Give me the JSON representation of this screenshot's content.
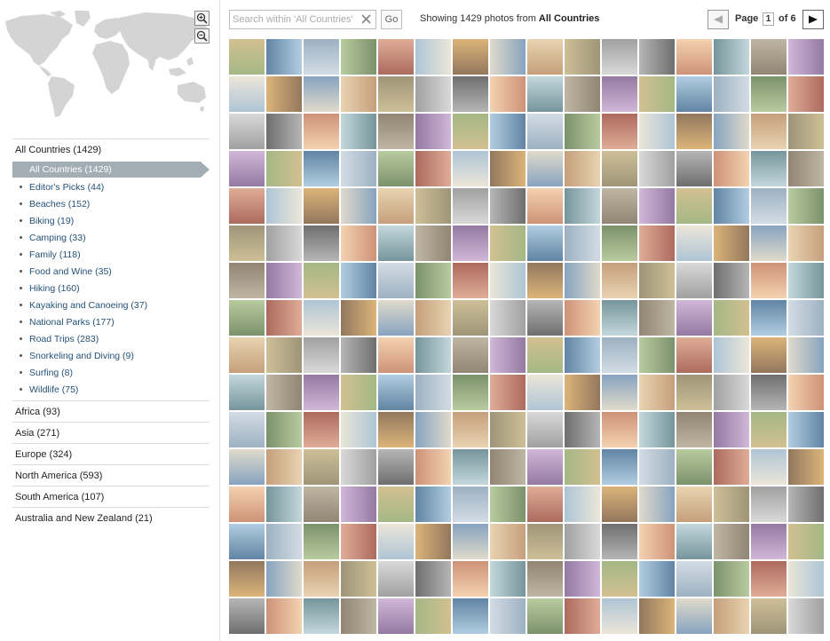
{
  "search": {
    "placeholder": "Search within 'All Countries'",
    "go_label": "Go"
  },
  "summary": {
    "prefix": "Showing 1429 photos from ",
    "location": "All Countries"
  },
  "pager": {
    "page_label": "Page",
    "current_page": "1",
    "of_label": "of 6"
  },
  "filter": {
    "all_countries_header": "All Countries (1429)",
    "selected_label": "All Countries (1429)",
    "categories": [
      "Editor's Picks (44)",
      "Beaches (152)",
      "Biking (19)",
      "Camping (33)",
      "Family (118)",
      "Food and Wine (35)",
      "Hiking (160)",
      "Kayaking and Canoeing (37)",
      "National Parks (177)",
      "Road Trips (283)",
      "Snorkeling and Diving (9)",
      "Surfing (8)",
      "Wildlife (75)"
    ],
    "regions": [
      "Africa (93)",
      "Asia (271)",
      "Europe (324)",
      "North America (593)",
      "South America (107)",
      "Australia and New Zealand (21)"
    ]
  },
  "icons": {
    "zoom_in": "zoom-in-magnifier-icon",
    "zoom_out": "zoom-out-magnifier-icon",
    "clear": "clear-x-icon",
    "prev": "left-arrow-icon",
    "next": "right-arrow-icon",
    "map": "world-map-icon"
  },
  "colors": {
    "selected_bar": "#a3aeb4",
    "link_text": "#24527a",
    "map_land": "#d4d4d4"
  }
}
